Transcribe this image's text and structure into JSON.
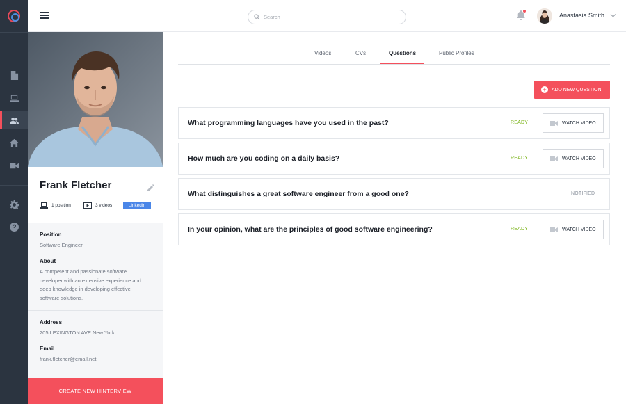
{
  "sidebar": {
    "items": [
      {
        "name": "documents"
      },
      {
        "name": "devices"
      },
      {
        "name": "candidates",
        "active": true
      },
      {
        "name": "home"
      },
      {
        "name": "videos"
      },
      {
        "name": "settings"
      },
      {
        "name": "help"
      }
    ]
  },
  "header": {
    "search_placeholder": "Search",
    "user_name": "Anastasia Smith"
  },
  "profile": {
    "name": "Frank Fletcher",
    "positions_count": "1 position",
    "videos_count": "3 videos",
    "linkedin_label": "LinkedIn",
    "position_label": "Position",
    "position_value": "Software Engineer",
    "about_label": "About",
    "about_value": "A competent and passionate software developer with an extensive experience and deep knowledge in developing effective software solutions.",
    "address_label": "Address",
    "address_value": "205 LEXINGTON AVE New York",
    "email_label": "Email",
    "email_value": "frank.fletcher@email.net",
    "create_button": "CREATE NEW HINTERVIEW"
  },
  "tabs": [
    {
      "label": "Videos"
    },
    {
      "label": "CVs"
    },
    {
      "label": "Questions",
      "active": true
    },
    {
      "label": "Public Profiles"
    }
  ],
  "add_question_button": "ADD NEW QUESTION",
  "questions": [
    {
      "text": "What programming languages have you used in the past?",
      "status": "READY",
      "action": "WATCH VIDEO"
    },
    {
      "text": "How much are you coding on a daily basis?",
      "status": "READY",
      "action": "WATCH VIDEO"
    },
    {
      "text": "What distinguishes a great software engineer from a good one?",
      "status": "NOTIFIED",
      "action": ""
    },
    {
      "text": "In your opinion, what are the principles of good software engineering?",
      "status": "READY",
      "action": "WATCH VIDEO"
    }
  ],
  "colors": {
    "accent": "#f4505c",
    "sidebar": "#2b3440",
    "ready": "#7ab317",
    "linkedin": "#4a86e8"
  }
}
